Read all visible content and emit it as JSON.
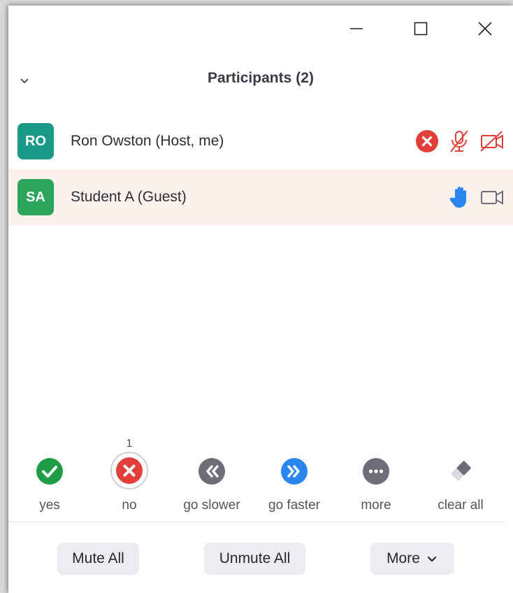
{
  "window_controls": {
    "minimize_icon": "minimize-icon",
    "maximize_icon": "maximize-icon",
    "close_icon": "close-icon"
  },
  "panel": {
    "title": "Participants",
    "count": "(2)"
  },
  "participants": [
    {
      "initials": "RO",
      "name": "Ron Owston (Host, me)",
      "avatar_color": "#1a9a86",
      "status_icons": [
        "no-reaction-icon",
        "muted-mic-icon",
        "video-off-icon"
      ],
      "highlighted": false
    },
    {
      "initials": "SA",
      "name": "Student A (Guest)",
      "avatar_color": "#2aa55a",
      "status_icons": [
        "raised-hand-icon",
        "video-camera-icon"
      ],
      "highlighted": true
    }
  ],
  "reactions": [
    {
      "label": "yes",
      "count": "",
      "icon": "check-icon",
      "color": "#1f9d46"
    },
    {
      "label": "no",
      "count": "1",
      "icon": "x-icon",
      "color": "#e33f3a",
      "selected": true
    },
    {
      "label": "go slower",
      "count": "",
      "icon": "rewind-icon",
      "color": "#6e6e7a"
    },
    {
      "label": "go faster",
      "count": "",
      "icon": "fast-forward-icon",
      "color": "#2b86f2"
    },
    {
      "label": "more",
      "count": "",
      "icon": "ellipsis-icon",
      "color": "#6e6e7a"
    },
    {
      "label": "clear all",
      "count": "",
      "icon": "eraser-icon",
      "color": "#6e6e7a"
    }
  ],
  "buttons": {
    "mute_all": "Mute All",
    "unmute_all": "Unmute All",
    "more": "More"
  },
  "colors": {
    "red": "#e33f3a",
    "blue": "#2b86f2",
    "highlight_row": "#fdf1ee"
  }
}
